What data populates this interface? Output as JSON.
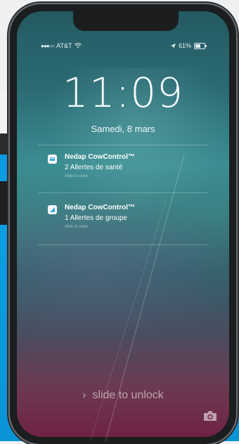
{
  "status_bar": {
    "signal": "●●●○○",
    "carrier": "AT&T",
    "battery": "61%",
    "battery_level": 0.61
  },
  "lock_screen": {
    "time": "11:09",
    "date": "Samedi, 8 mars",
    "unlock_hint": "slide to unlock"
  },
  "notifications": [
    {
      "app": "Nedap CowControl™",
      "message": "2 Allertes de santé",
      "hint": "slide to view",
      "icon": "cow-control-app-icon"
    },
    {
      "app": "Nedap CowControl™",
      "message": "1 Allertes de groupe",
      "hint": "slide to view",
      "icon": "cow-control-app-icon"
    }
  ],
  "colors": {
    "accent_blue": "#0a9be0",
    "screen_top": "#245a62",
    "screen_bottom": "#6e2244"
  }
}
